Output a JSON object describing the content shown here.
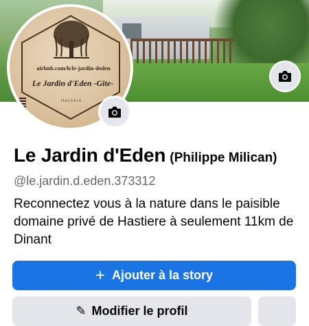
{
  "profile": {
    "name": "Le Jardin d'Eden",
    "alternate_name": "(Philippe Milican)",
    "username": "@le.jardin.d.eden.373312",
    "bio": "Reconnectez vous à la nature dans le paisible domaine privé de Hastiere à seulement 11km de Dinant"
  },
  "avatar_image": {
    "url_text": "airbnb.com/h/le-jardin-deden",
    "title_text": "Le Jardin d'Eden -Gite-",
    "place_text": "Hastiere"
  },
  "icons": {
    "cover_camera": "camera-icon",
    "avatar_camera": "camera-icon",
    "add": "plus-icon",
    "edit": "pencil-icon"
  },
  "actions": {
    "add_story_plus": "+",
    "add_story_label": "Ajouter à la story",
    "edit_profile_icon": "✎",
    "edit_profile_label": "Modifier le profil"
  },
  "colors": {
    "primary": "#1b74e4",
    "secondary_button": "#e4e6eb",
    "text": "#050505",
    "muted_text": "#65676b"
  }
}
